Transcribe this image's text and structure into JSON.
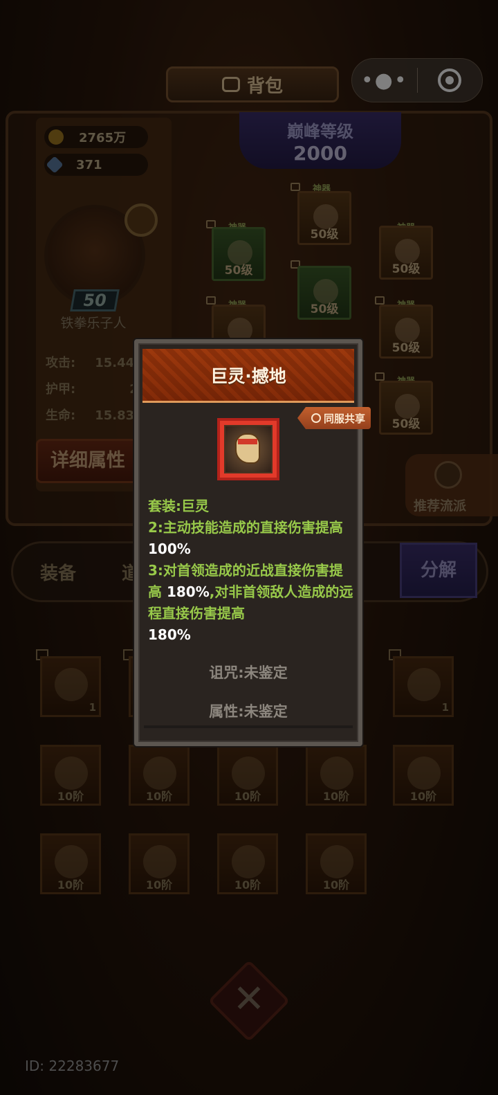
{
  "header": {
    "title": "背包"
  },
  "capsule": {
    "more_glyph": "•●•"
  },
  "resources": {
    "gold": "2765万",
    "gems": "371"
  },
  "hero": {
    "level": "50",
    "name": "铁拳乐子人",
    "stats": [
      {
        "label": "攻击:",
        "value": "15.44"
      },
      {
        "label": "护甲:",
        "value": "280"
      },
      {
        "label": "生命:",
        "value": "15.83"
      }
    ],
    "detail_button": "详细属性"
  },
  "peak": {
    "label": "巅峰等级",
    "value": "2000"
  },
  "equip_slots": [
    {
      "tag": "神器",
      "level": "50级"
    },
    {
      "tag": "神器",
      "level": "50级"
    },
    {
      "tag": "神器",
      "level": "50级"
    },
    {
      "tag": "神器",
      "level": "50级"
    },
    {
      "tag": "神器",
      "level": "50级"
    },
    {
      "tag": "神器",
      "level": "50级"
    },
    {
      "tag": "神器",
      "level": "50级"
    }
  ],
  "recommend": "推荐流派",
  "tabs": {
    "equip": "装备",
    "items_partial": "道",
    "decompose": "分解"
  },
  "inventory": {
    "row1": [
      {
        "count": "1"
      },
      {
        "count": ""
      },
      {
        "count": ""
      },
      {
        "count": ""
      },
      {
        "count": "1"
      }
    ],
    "row2": [
      "10阶",
      "10阶",
      "10阶",
      "10阶",
      "10阶"
    ],
    "row3": [
      "10阶",
      "10阶",
      "10阶",
      "10阶"
    ]
  },
  "footer": {
    "id": "ID: 22283677"
  },
  "popup": {
    "title": "巨灵·撼地",
    "share_label": "同服共享",
    "set_line": "套装:巨灵",
    "bonus2_text": "2:主动技能造成的直接伤害提高 ",
    "bonus2_value": "100%",
    "bonus3_text_a": "3:对首领造成的近战直接伤害提高 ",
    "bonus3_value_a": "180%",
    "bonus3_text_b": ",对非首领敌人造成的远程直接伤害提高",
    "bonus3_value_b": "180%",
    "curse": "诅咒:未鉴定",
    "attributes": "属性:未鉴定"
  }
}
